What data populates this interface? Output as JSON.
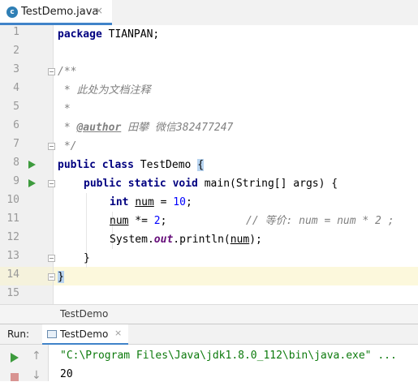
{
  "tab": {
    "filename": "TestDemo.java",
    "icon_letter": "c",
    "close_glyph": "×"
  },
  "editor": {
    "line_numbers": [
      "1",
      "2",
      "3",
      "4",
      "5",
      "6",
      "7",
      "8",
      "9",
      "10",
      "11",
      "12",
      "13",
      "14",
      "15"
    ],
    "code": {
      "l1_kw": "package",
      "l1_rest": " TIANPAN;",
      "l3": "/**",
      "l4": " * 此处为文档注释",
      "l5": " *",
      "l6_pre": " * ",
      "l6_tag": "@author",
      "l6_rest": " 田攀 微信382477247",
      "l7": " */",
      "l8_kw": "public class",
      "l8_name": " TestDemo ",
      "l8_brace": "{",
      "l9_kw": "public static void",
      "l9_rest": " main(String[] args) {",
      "l10_type": "int",
      "l10_var": "num",
      "l10_eq": " = ",
      "l10_num": "10",
      "l10_end": ";",
      "l11_var": "num",
      "l11_op": " *= ",
      "l11_num": "2",
      "l11_end": ";",
      "l11_comment": "// 等价: num = num * 2 ;",
      "l12_pre": "System.",
      "l12_field": "out",
      "l12_mid": ".println(",
      "l12_var": "num",
      "l12_end": ");",
      "l13": "}",
      "l14": "}"
    }
  },
  "breadcrumb": {
    "item": "TestDemo"
  },
  "run_panel": {
    "label": "Run:",
    "tab_label": "TestDemo",
    "tab_close": "×",
    "command_line": "\"C:\\Program Files\\Java\\jdk1.8.0_112\\bin\\java.exe\" ...",
    "output": "20",
    "up_glyph": "↑",
    "down_glyph": "↓"
  },
  "colors": {
    "keyword": "#000080",
    "comment": "#808080",
    "number": "#0000ff",
    "field": "#660e7a",
    "run_green": "#3d9b3d",
    "accent": "#4083c9"
  }
}
